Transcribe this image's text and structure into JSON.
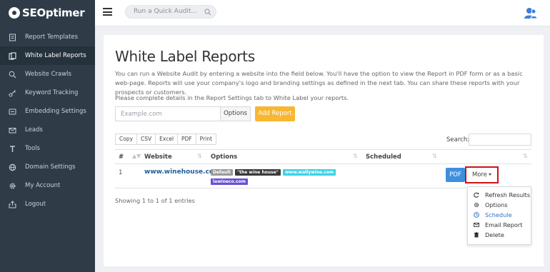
{
  "app": {
    "brand": "SEOptimer"
  },
  "topbar": {
    "search_placeholder": "Run a Quick Audit..."
  },
  "sidebar": {
    "items": [
      {
        "label": "Report Templates",
        "icon": "report-templates-icon",
        "active": false
      },
      {
        "label": "White Label Reports",
        "icon": "white-label-icon",
        "active": true
      },
      {
        "label": "Website Crawls",
        "icon": "search-icon",
        "active": false
      },
      {
        "label": "Keyword Tracking",
        "icon": "key-icon",
        "active": false
      },
      {
        "label": "Embedding Settings",
        "icon": "embed-icon",
        "active": false
      },
      {
        "label": "Leads",
        "icon": "envelope-icon",
        "active": false
      },
      {
        "label": "Tools",
        "icon": "tools-icon",
        "active": false
      },
      {
        "label": "Domain Settings",
        "icon": "globe-icon",
        "active": false
      },
      {
        "label": "My Account",
        "icon": "gear-icon",
        "active": false
      },
      {
        "label": "Logout",
        "icon": "logout-icon",
        "active": false
      }
    ]
  },
  "main": {
    "title": "White Label Reports",
    "description": "You can run a Website Audit by entering a website into the field below. You'll have the option to view the Report in PDF form or as a basic web-page. Reports will use your company's logo and branding settings as defined in the next tab. You can share these reports with your prospects or customers.",
    "description2": "Please complete details in the Report Settings tab to White Label your reports.",
    "url_placeholder": "Example.com",
    "options_label": "Options",
    "add_report_label": "Add Report"
  },
  "table": {
    "export_buttons": [
      "Copy",
      "CSV",
      "Excel",
      "PDF",
      "Print"
    ],
    "search_label": "Search:",
    "columns": [
      "#",
      "Website",
      "Options",
      "Scheduled"
    ],
    "rows": [
      {
        "num": "1",
        "website": "www.winehouse.com",
        "tags": [
          {
            "text": "Default",
            "color": "#9a9a9a"
          },
          {
            "text": "\"the wine house\"",
            "color": "#3a3a3a"
          },
          {
            "text": "www.wallywine.com",
            "color": "#3fd1e6"
          },
          {
            "text": "lawineco.com",
            "color": "#6a4fd4"
          }
        ],
        "scheduled": "",
        "pdf_label": "PDF",
        "more_label": "More"
      }
    ],
    "info": "Showing 1 to 1 of 1 entries"
  },
  "dropdown": {
    "items": [
      {
        "label": "Refresh Results",
        "icon": "refresh-icon"
      },
      {
        "label": "Options",
        "icon": "gear-icon"
      },
      {
        "label": "Schedule",
        "icon": "clock-icon"
      },
      {
        "label": "Email Report",
        "icon": "envelope-icon"
      },
      {
        "label": "Delete",
        "icon": "trash-icon"
      }
    ]
  },
  "colors": {
    "sidebar_bg": "#2f3c48",
    "accent_orange": "#f7b731",
    "pdf_blue": "#3d8fe0",
    "highlight_red": "#d0101a",
    "link_blue": "#1f5e99"
  }
}
